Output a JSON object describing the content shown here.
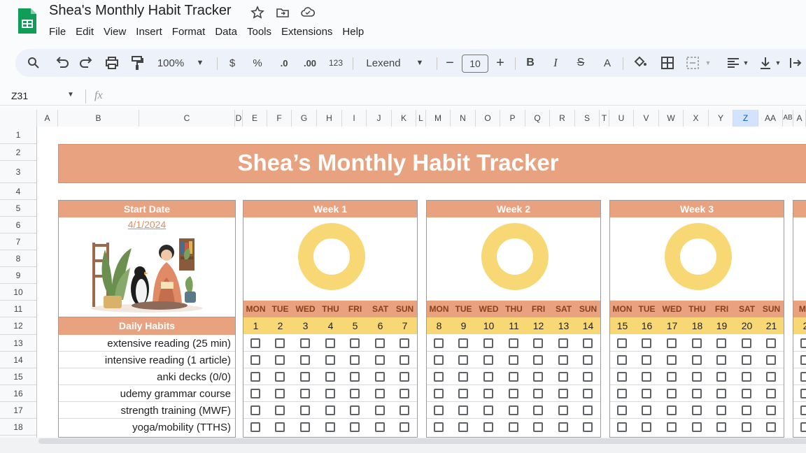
{
  "app": {
    "title": "Shea's Monthly Habit Tracker",
    "brand_color": "#0f9d58"
  },
  "menu": [
    "File",
    "Edit",
    "View",
    "Insert",
    "Format",
    "Data",
    "Tools",
    "Extensions",
    "Help"
  ],
  "toolbar": {
    "zoom": "100%",
    "currency": "$",
    "percent": "%",
    "dec_decrease": ".0",
    "dec_increase": ".00",
    "number_format": "123",
    "font": "Lexend",
    "font_size": "10",
    "bold": "B",
    "italic": "I",
    "strike": "S",
    "text_color": "A"
  },
  "namebox": "Z31",
  "fx": "fx",
  "columns": [
    "A",
    "B",
    "C",
    "D",
    "E",
    "F",
    "G",
    "H",
    "I",
    "J",
    "K",
    "L",
    "M",
    "N",
    "O",
    "P",
    "Q",
    "R",
    "S",
    "T",
    "U",
    "V",
    "W",
    "X",
    "Y",
    "Z",
    "AA",
    "AB",
    "A"
  ],
  "selected_column": "Z",
  "rows": [
    "1",
    "2",
    "3",
    "4",
    "5",
    "6",
    "7",
    "8",
    "9",
    "10",
    "11",
    "12",
    "13",
    "14",
    "15",
    "16",
    "17",
    "18"
  ],
  "sheet": {
    "banner": "Shea’s Monthly Habit Tracker",
    "start_date_label": "Start Date",
    "start_date": "4/1/2024",
    "daily_habits_label": "Daily Habits",
    "habits": [
      "extensive reading (25 min)",
      "intensive reading (1 article)",
      "anki decks (0/0)",
      "udemy grammar course",
      "strength training (MWF)",
      "yoga/mobility (TTHS)"
    ],
    "days": [
      "MON",
      "TUE",
      "WED",
      "THU",
      "FRI",
      "SAT",
      "SUN"
    ],
    "weeks": [
      {
        "label": "Week 1",
        "dates": [
          "1",
          "2",
          "3",
          "4",
          "5",
          "6",
          "7"
        ],
        "progress": 0
      },
      {
        "label": "Week 2",
        "dates": [
          "8",
          "9",
          "10",
          "11",
          "12",
          "13",
          "14"
        ],
        "progress": 0
      },
      {
        "label": "Week 3",
        "dates": [
          "15",
          "16",
          "17",
          "18",
          "19",
          "20",
          "21"
        ],
        "progress": 0
      },
      {
        "label": "",
        "dates": [
          "2"
        ],
        "progress": 0
      }
    ],
    "partial_day": "MO",
    "colors": {
      "salmon": "#e9a27f",
      "yellow": "#f7d874",
      "ring": "#f7d874",
      "date_link": "#e38d5f"
    }
  }
}
